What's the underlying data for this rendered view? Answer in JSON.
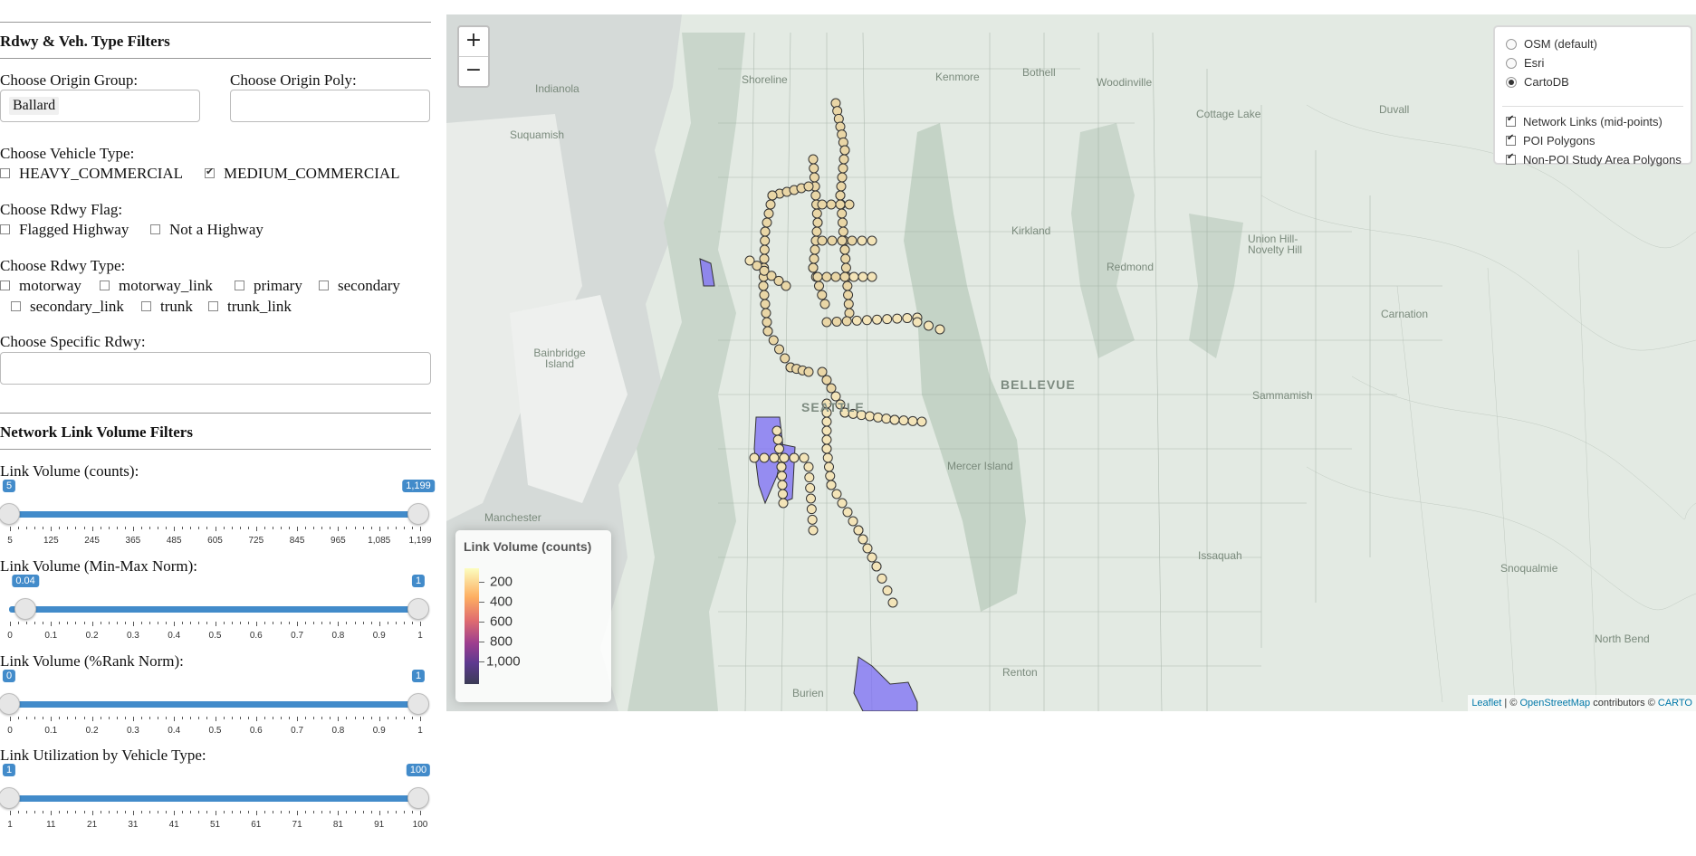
{
  "filters": {
    "rdwy_section_title": "Rdwy & Veh. Type Filters",
    "origin_group_label": "Choose Origin Group:",
    "origin_group_value": "Ballard",
    "origin_poly_label": "Choose Origin Poly:",
    "origin_poly_value": "",
    "vehicle_type_label": "Choose Vehicle Type:",
    "vehicle_types": [
      {
        "label": "HEAVY_COMMERCIAL",
        "checked": false
      },
      {
        "label": "MEDIUM_COMMERCIAL",
        "checked": true
      }
    ],
    "rdwy_flag_label": "Choose Rdwy Flag:",
    "rdwy_flags": [
      {
        "label": "Flagged Highway",
        "checked": false
      },
      {
        "label": "Not a Highway",
        "checked": false
      }
    ],
    "rdwy_type_label": "Choose Rdwy Type:",
    "rdwy_types": [
      {
        "label": "motorway",
        "checked": false
      },
      {
        "label": "motorway_link",
        "checked": false
      },
      {
        "label": "primary",
        "checked": false
      },
      {
        "label": "secondary",
        "checked": false
      },
      {
        "label": "secondary_link",
        "checked": false
      },
      {
        "label": "trunk",
        "checked": false
      },
      {
        "label": "trunk_link",
        "checked": false
      }
    ],
    "specific_rdwy_label": "Choose Specific Rdwy:",
    "specific_rdwy_value": ""
  },
  "volume": {
    "section_title": "Network Link Volume Filters",
    "sliders": [
      {
        "label": "Link Volume (counts):",
        "min_label": "5",
        "max_label": "1,199",
        "low": 5,
        "high": 1199,
        "min": 5,
        "max": 1199,
        "ticks": [
          "5",
          "125",
          "245",
          "365",
          "485",
          "605",
          "725",
          "845",
          "965",
          "1,085",
          "1,199"
        ]
      },
      {
        "label": "Link Volume (Min-Max Norm):",
        "min_label": "0.04",
        "max_label": "1",
        "low": 0.04,
        "high": 1,
        "min": 0,
        "max": 1,
        "ticks": [
          "0",
          "0.1",
          "0.2",
          "0.3",
          "0.4",
          "0.5",
          "0.6",
          "0.7",
          "0.8",
          "0.9",
          "1"
        ]
      },
      {
        "label": "Link Volume (%Rank Norm):",
        "min_label": "0",
        "max_label": "1",
        "low": 0,
        "high": 1,
        "min": 0,
        "max": 1,
        "ticks": [
          "0",
          "0.1",
          "0.2",
          "0.3",
          "0.4",
          "0.5",
          "0.6",
          "0.7",
          "0.8",
          "0.9",
          "1"
        ]
      },
      {
        "label": "Link Utilization by Vehicle Type:",
        "min_label": "1",
        "max_label": "100",
        "low": 1,
        "high": 100,
        "min": 1,
        "max": 100,
        "ticks": [
          "1",
          "11",
          "21",
          "31",
          "41",
          "51",
          "61",
          "71",
          "81",
          "91",
          "100"
        ]
      }
    ]
  },
  "map": {
    "zoom_in": "+",
    "zoom_out": "−",
    "basemaps": [
      {
        "label": "OSM (default)",
        "selected": false
      },
      {
        "label": "Esri",
        "selected": false
      },
      {
        "label": "CartoDB",
        "selected": true
      }
    ],
    "overlays": [
      {
        "label": "Network Links (mid-points)",
        "checked": true
      },
      {
        "label": "POI Polygons",
        "checked": true
      },
      {
        "label": "Non-POI Study Area Polygons",
        "checked": true
      }
    ],
    "legend": {
      "title": "Link Volume (counts)",
      "labels": [
        "200",
        "400",
        "600",
        "800",
        "1,000"
      ]
    },
    "attribution": {
      "leaflet": "Leaflet",
      "sep": " | © ",
      "osm": "OpenStreetMap",
      "rest": " contributors © ",
      "carto": "CARTO"
    },
    "places": [
      "Indianola",
      "Shoreline",
      "Kenmore",
      "Bothell",
      "Woodinville",
      "Duvall",
      "Cottage Lake",
      "Suquamish",
      "Kirkland",
      "Union Hill-Novelty Hill",
      "Redmond",
      "Carnation",
      "Bainbridge Island",
      "BELLEVUE",
      "SEATTLE",
      "Sammamish",
      "Mercer Island",
      "Manchester",
      "Issaquah",
      "Snoqualmie",
      "North Bend",
      "Burien",
      "Renton"
    ],
    "colors": {
      "accent": "#428bca",
      "poi_polygon": "#7b6cf6",
      "point_light": "#f5e6b8",
      "water": "#d7dcda",
      "land": "#e3eae3"
    }
  }
}
